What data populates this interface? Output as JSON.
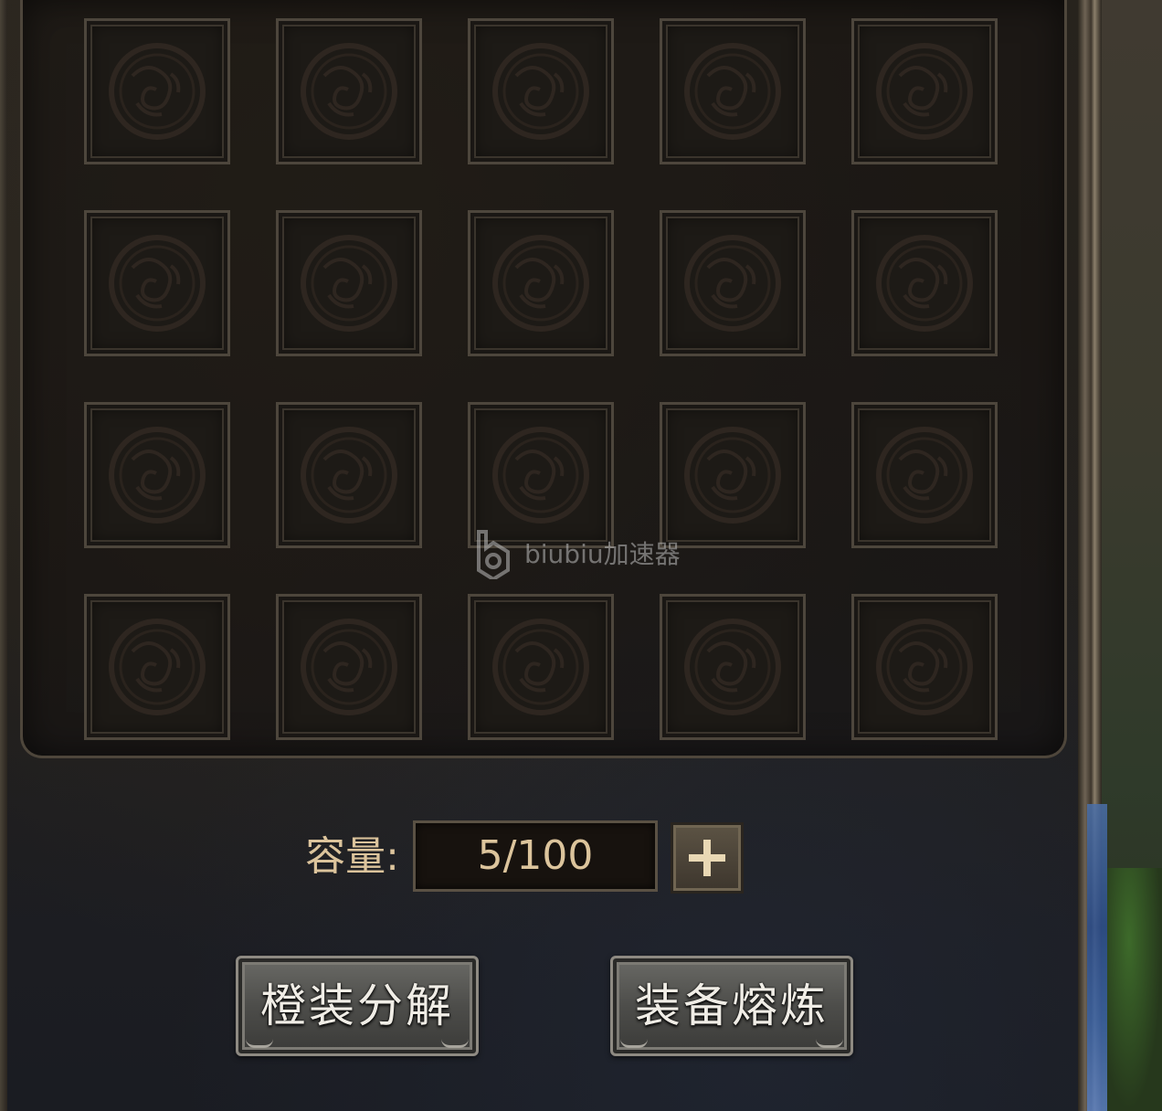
{
  "inventory": {
    "rows": 4,
    "columns": 5,
    "slots": [
      {
        "empty": true
      },
      {
        "empty": true
      },
      {
        "empty": true
      },
      {
        "empty": true
      },
      {
        "empty": true
      },
      {
        "empty": true
      },
      {
        "empty": true
      },
      {
        "empty": true
      },
      {
        "empty": true
      },
      {
        "empty": true
      },
      {
        "empty": true
      },
      {
        "empty": true
      },
      {
        "empty": true
      },
      {
        "empty": true
      },
      {
        "empty": true
      },
      {
        "empty": true
      },
      {
        "empty": true
      },
      {
        "empty": true
      },
      {
        "empty": true
      },
      {
        "empty": true
      }
    ],
    "slot_icon": "dragon-emblem-icon"
  },
  "capacity": {
    "label": "容量:",
    "value": "5/100",
    "expand_icon": "plus-icon"
  },
  "actions": {
    "decompose_label": "橙装分解",
    "smelt_label": "装备熔炼"
  },
  "watermark": {
    "text": "biubiu加速器",
    "logo": "biubiu-logo-icon"
  },
  "colors": {
    "text_gold": "#dcc49c",
    "button_text": "#f0ede6",
    "slot_border": "#4d463c"
  }
}
